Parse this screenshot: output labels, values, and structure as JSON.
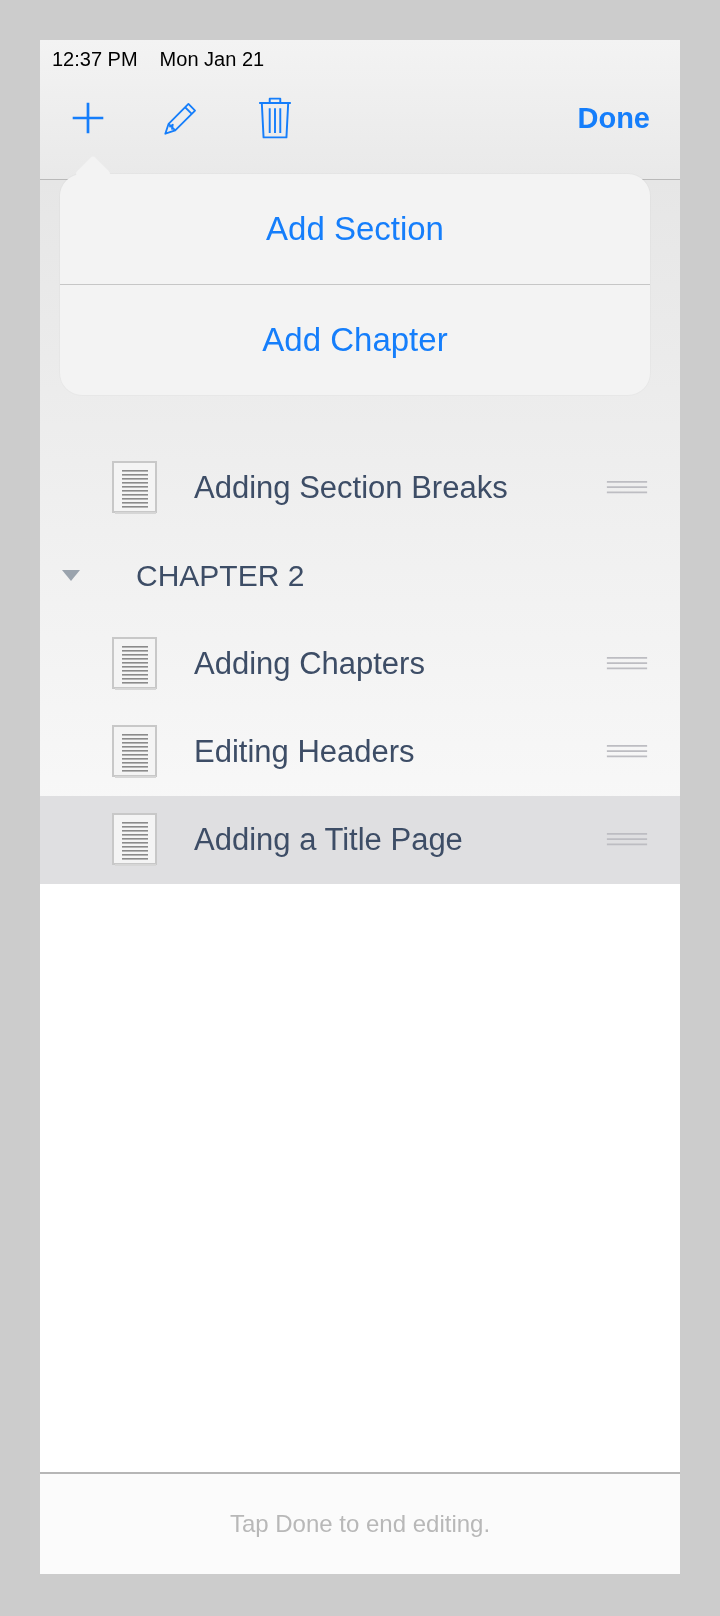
{
  "status_bar": {
    "time": "12:37 PM",
    "date": "Mon Jan 21"
  },
  "toolbar": {
    "done": "Done"
  },
  "popover": {
    "items": [
      "Add Section",
      "Add Chapter"
    ]
  },
  "outline": [
    {
      "kind": "section",
      "title": "Adding Section Breaks",
      "selected": false
    },
    {
      "kind": "chapter",
      "title": "CHAPTER 2",
      "expanded": true,
      "children": [
        {
          "kind": "section",
          "title": "Adding Chapters",
          "selected": false
        },
        {
          "kind": "section",
          "title": "Editing Headers",
          "selected": false
        },
        {
          "kind": "section",
          "title": "Adding a Title Page",
          "selected": true
        }
      ]
    }
  ],
  "footer": {
    "hint": "Tap Done to end editing."
  }
}
